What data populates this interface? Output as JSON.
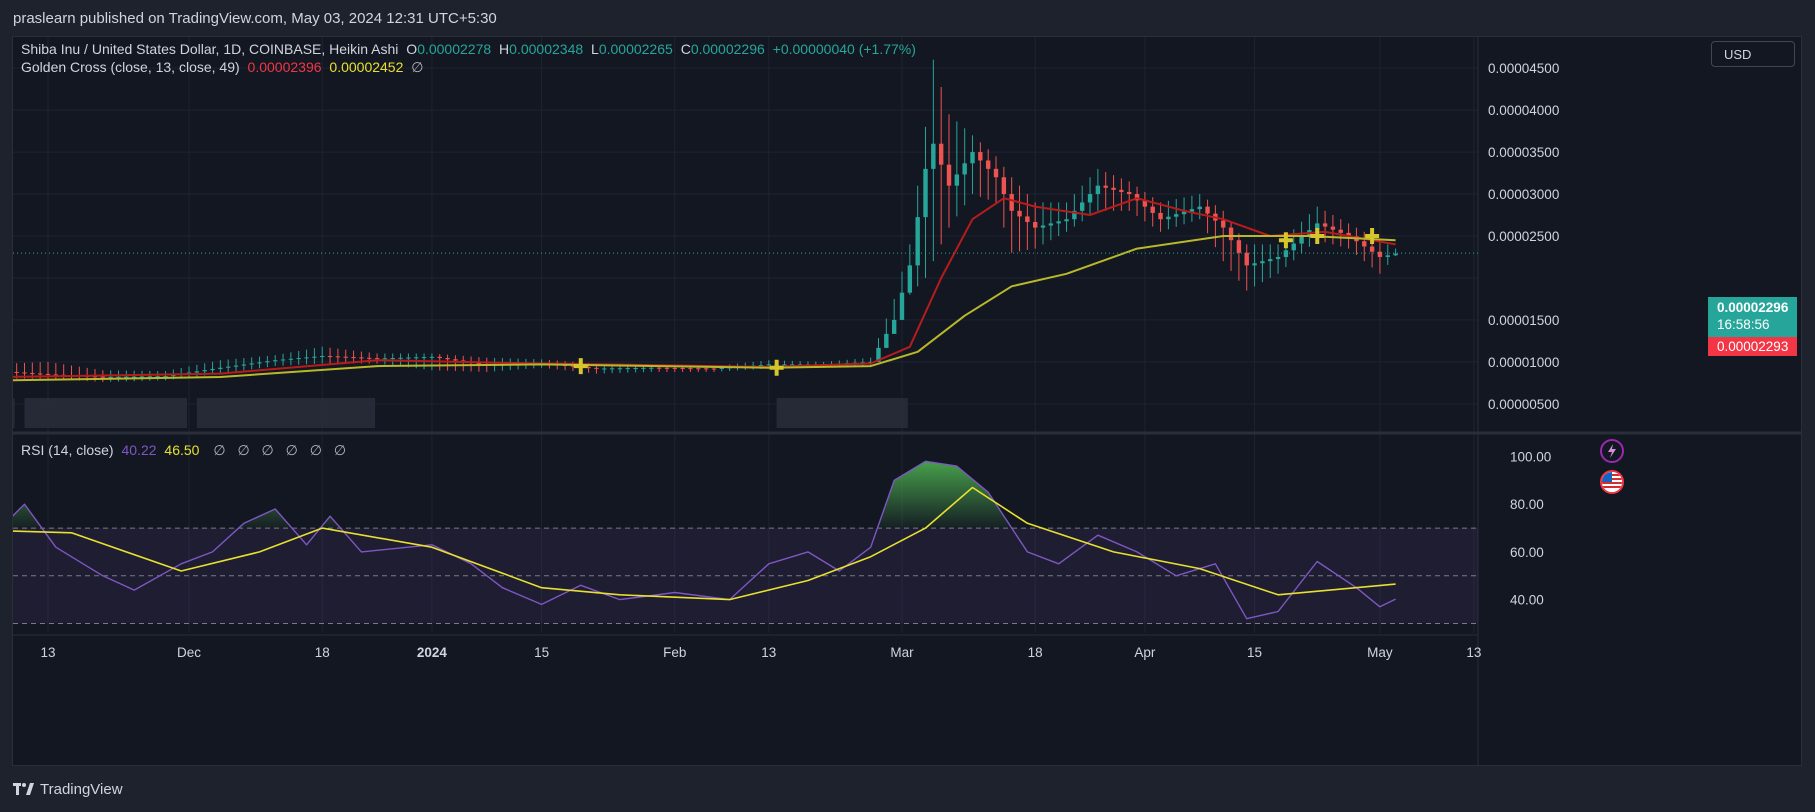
{
  "header": {
    "published": "praslearn published on TradingView.com, May 03, 2024 12:31 UTC+5:30"
  },
  "footer": {
    "brand": "TradingView"
  },
  "legend": {
    "symbol": "Shiba Inu / United States Dollar, 1D, COINBASE, Heikin Ashi",
    "o_label": "O",
    "o": "0.00002278",
    "h_label": "H",
    "h": "0.00002348",
    "l_label": "L",
    "l": "0.00002265",
    "c_label": "C",
    "c": "0.00002296",
    "change": "+0.00000040 (+1.77%)",
    "indicator": "Golden Cross (close, 13, close, 49)",
    "ma_fast": "0.00002396",
    "ma_slow": "0.00002452",
    "null_mark": "∅"
  },
  "rsi_legend": {
    "label": "RSI (14, close)",
    "rsi": "40.22",
    "ma": "46.50",
    "nulls": [
      "∅",
      "∅",
      "∅",
      "∅",
      "∅",
      "∅"
    ]
  },
  "currency_button": "USD",
  "price_tags": {
    "last": "0.00002296",
    "countdown": "16:58:56",
    "ma": "0.00002293"
  },
  "colors": {
    "up": "#26a69a",
    "down": "#ef5350",
    "ma_fast": "#b71c1c",
    "ma_slow": "#b8b82a",
    "rsi": "#7e57c2",
    "rsi_ma": "#e8e030",
    "cross": "#d4c62b",
    "tag_last": "#26a69a",
    "tag_ma": "#f23645"
  },
  "icons": [
    "lightning-icon",
    "us-flag-icon",
    "tradingview-logo-icon"
  ],
  "chart_data": [
    {
      "type": "candlestick",
      "title": "",
      "price_axis": {
        "ticks": [
          4.5e-06,
          4e-06,
          3.5e-06,
          3e-06,
          2.5e-06,
          2e-06,
          1.5e-06,
          1e-06,
          5e-07
        ],
        "tick_labels": [
          "0.00004500",
          "0.00004000",
          "0.00003500",
          "0.00003000",
          "0.00002500",
          "",
          "0.00001500",
          "0.00001000",
          "0.00000500"
        ],
        "scale_note": "price in USD",
        "ylim": [
          2e-07,
          4.8e-06
        ]
      },
      "time_axis": {
        "ticks": [
          "2023-11-13",
          "2023-12-01",
          "2023-12-18",
          "2024-01-01",
          "2024-01-15",
          "2024-02-01",
          "2024-02-13",
          "2024-03-01",
          "2024-03-18",
          "2024-04-01",
          "2024-04-15",
          "2024-05-01",
          "2024-05-13"
        ],
        "tick_labels": [
          "13",
          "Dec",
          "18",
          "2024",
          "15",
          "Feb",
          "13",
          "Mar",
          "18",
          "Apr",
          "15",
          "May",
          "13"
        ],
        "bold_labels": [
          "2024"
        ]
      },
      "keypoints": [
        {
          "date": "2023-11-08",
          "close": 8.8e-07,
          "high": 9.8e-07,
          "low": 8e-07
        },
        {
          "date": "2023-11-13",
          "close": 8.5e-07,
          "high": 1e-06,
          "low": 8e-07
        },
        {
          "date": "2023-11-20",
          "close": 8.2e-07,
          "high": 9e-07,
          "low": 7.6e-07
        },
        {
          "date": "2023-11-28",
          "close": 8.3e-07,
          "high": 8.9e-07,
          "low": 7.8e-07
        },
        {
          "date": "2023-12-05",
          "close": 9.3e-07,
          "high": 1.02e-06,
          "low": 8.6e-07
        },
        {
          "date": "2023-12-12",
          "close": 1.02e-06,
          "high": 1.08e-06,
          "low": 9.5e-07
        },
        {
          "date": "2023-12-18",
          "close": 1.07e-06,
          "high": 1.18e-06,
          "low": 9.8e-07
        },
        {
          "date": "2023-12-25",
          "close": 1.04e-06,
          "high": 1.1e-06,
          "low": 9.8e-07
        },
        {
          "date": "2024-01-01",
          "close": 1.06e-06,
          "high": 1.1e-06,
          "low": 9e-07
        },
        {
          "date": "2024-01-08",
          "close": 9.6e-07,
          "high": 1.05e-06,
          "low": 8.8e-07
        },
        {
          "date": "2024-01-15",
          "close": 9.8e-07,
          "high": 1.03e-06,
          "low": 9.3e-07
        },
        {
          "date": "2024-01-22",
          "close": 9.2e-07,
          "high": 9.8e-07,
          "low": 8.6e-07
        },
        {
          "date": "2024-01-29",
          "close": 9.3e-07,
          "high": 9.7e-07,
          "low": 8.8e-07
        },
        {
          "date": "2024-02-06",
          "close": 9.2e-07,
          "high": 9.5e-07,
          "low": 8.8e-07
        },
        {
          "date": "2024-02-13",
          "close": 9.7e-07,
          "high": 1.02e-06,
          "low": 9.2e-07
        },
        {
          "date": "2024-02-20",
          "close": 9.7e-07,
          "high": 1e-06,
          "low": 9.3e-07
        },
        {
          "date": "2024-02-26",
          "close": 1e-06,
          "high": 1.05e-06,
          "low": 9.5e-07
        },
        {
          "date": "2024-02-29",
          "close": 1.5e-06,
          "high": 1.75e-06,
          "low": 1.4e-06
        },
        {
          "date": "2024-03-02",
          "close": 2.15e-06,
          "high": 2.4e-06,
          "low": 1.8e-06
        },
        {
          "date": "2024-03-04",
          "close": 3.3e-06,
          "high": 3.8e-06,
          "low": 2e-06
        },
        {
          "date": "2024-03-05",
          "close": 3.6e-06,
          "high": 4.6e-06,
          "low": 2.2e-06
        },
        {
          "date": "2024-03-07",
          "close": 3.1e-06,
          "high": 3.95e-06,
          "low": 2.6e-06
        },
        {
          "date": "2024-03-10",
          "close": 3.5e-06,
          "high": 3.7e-06,
          "low": 3e-06
        },
        {
          "date": "2024-03-13",
          "close": 3.2e-06,
          "high": 3.45e-06,
          "low": 2.9e-06
        },
        {
          "date": "2024-03-15",
          "close": 2.8e-06,
          "high": 3.2e-06,
          "low": 2.3e-06
        },
        {
          "date": "2024-03-18",
          "close": 2.6e-06,
          "high": 2.9e-06,
          "low": 2.35e-06
        },
        {
          "date": "2024-03-22",
          "close": 2.7e-06,
          "high": 2.9e-06,
          "low": 2.55e-06
        },
        {
          "date": "2024-03-26",
          "close": 3.1e-06,
          "high": 3.3e-06,
          "low": 2.8e-06
        },
        {
          "date": "2024-03-30",
          "close": 3e-06,
          "high": 3.15e-06,
          "low": 2.8e-06
        },
        {
          "date": "2024-04-03",
          "close": 2.7e-06,
          "high": 2.9e-06,
          "low": 2.55e-06
        },
        {
          "date": "2024-04-08",
          "close": 2.85e-06,
          "high": 3e-06,
          "low": 2.7e-06
        },
        {
          "date": "2024-04-11",
          "close": 2.6e-06,
          "high": 2.8e-06,
          "low": 2.2e-06
        },
        {
          "date": "2024-04-14",
          "close": 2.15e-06,
          "high": 2.4e-06,
          "low": 1.85e-06
        },
        {
          "date": "2024-04-18",
          "close": 2.25e-06,
          "high": 2.4e-06,
          "low": 2.05e-06
        },
        {
          "date": "2024-04-23",
          "close": 2.65e-06,
          "high": 2.85e-06,
          "low": 2.45e-06
        },
        {
          "date": "2024-04-27",
          "close": 2.5e-06,
          "high": 2.65e-06,
          "low": 2.35e-06
        },
        {
          "date": "2024-05-01",
          "close": 2.25e-06,
          "high": 2.45e-06,
          "low": 2.05e-06
        },
        {
          "date": "2024-05-03",
          "close": 2.29e-06,
          "high": 2.35e-06,
          "low": 2.26e-06
        }
      ],
      "series": [
        {
          "name": "",
          "color": "#b71c1c",
          "points": [
            [
              "2023-11-08",
              8.2e-07
            ],
            [
              "2023-12-05",
              8.6e-07
            ],
            [
              "2023-12-25",
              1.02e-06
            ],
            [
              "2024-01-15",
              9.8e-07
            ],
            [
              "2024-02-13",
              9.4e-07
            ],
            [
              "2024-02-26",
              9.8e-07
            ],
            [
              "2024-03-02",
              1.18e-06
            ],
            [
              "2024-03-06",
              2e-06
            ],
            [
              "2024-03-10",
              2.7e-06
            ],
            [
              "2024-03-14",
              2.95e-06
            ],
            [
              "2024-03-18",
              2.85e-06
            ],
            [
              "2024-03-25",
              2.75e-06
            ],
            [
              "2024-03-31",
              2.95e-06
            ],
            [
              "2024-04-06",
              2.8e-06
            ],
            [
              "2024-04-11",
              2.7e-06
            ],
            [
              "2024-04-17",
              2.5e-06
            ],
            [
              "2024-04-24",
              2.55e-06
            ],
            [
              "2024-05-03",
              2.4e-06
            ]
          ]
        },
        {
          "name": "",
          "color": "#b8b82a",
          "points": [
            [
              "2023-11-08",
              7.8e-07
            ],
            [
              "2023-12-05",
              8.2e-07
            ],
            [
              "2023-12-25",
              9.5e-07
            ],
            [
              "2024-01-15",
              9.7e-07
            ],
            [
              "2024-02-13",
              9.3e-07
            ],
            [
              "2024-02-26",
              9.5e-07
            ],
            [
              "2024-03-03",
              1.12e-06
            ],
            [
              "2024-03-09",
              1.55e-06
            ],
            [
              "2024-03-15",
              1.9e-06
            ],
            [
              "2024-03-22",
              2.05e-06
            ],
            [
              "2024-03-31",
              2.35e-06
            ],
            [
              "2024-04-11",
              2.5e-06
            ],
            [
              "2024-04-22",
              2.5e-06
            ],
            [
              "2024-05-03",
              2.45e-06
            ]
          ]
        }
      ],
      "crosses": [
        {
          "date": "2024-01-20",
          "price": 9.5e-07
        },
        {
          "date": "2024-02-14",
          "price": 9.3e-07
        },
        {
          "date": "2024-04-19",
          "price": 2.45e-06
        },
        {
          "date": "2024-04-23",
          "price": 2.5e-06
        },
        {
          "date": "2024-04-30",
          "price": 2.5e-06
        }
      ],
      "shaded_ranges": [
        {
          "from": "2023-11-06",
          "to": "2023-11-09"
        },
        {
          "from": "2023-11-10",
          "to": "2023-12-01"
        },
        {
          "from": "2023-12-02",
          "to": "2023-12-25"
        },
        {
          "from": "2024-02-14",
          "to": "2024-03-02"
        }
      ],
      "last_price": 2.296e-05
    },
    {
      "type": "line",
      "title": "RSI (14, close)",
      "ylim": [
        26,
        104
      ],
      "y_ticks": [
        100,
        80,
        60,
        40
      ],
      "y_tick_labels": [
        "100.00",
        "80.00",
        "60.00",
        "40.00"
      ],
      "bands": {
        "upper": 70,
        "middle": 50,
        "lower": 30
      },
      "series": [
        {
          "name": "",
          "color": "#7e57c2",
          "points": [
            [
              "2023-11-06",
              67
            ],
            [
              "2023-11-10",
              80
            ],
            [
              "2023-11-14",
              62
            ],
            [
              "2023-11-20",
              50
            ],
            [
              "2023-11-24",
              44
            ],
            [
              "2023-11-30",
              55
            ],
            [
              "2023-12-04",
              60
            ],
            [
              "2023-12-08",
              72
            ],
            [
              "2023-12-12",
              78
            ],
            [
              "2023-12-16",
              63
            ],
            [
              "2023-12-19",
              75
            ],
            [
              "2023-12-23",
              60
            ],
            [
              "2024-01-01",
              63
            ],
            [
              "2024-01-06",
              55
            ],
            [
              "2024-01-10",
              45
            ],
            [
              "2024-01-15",
              38
            ],
            [
              "2024-01-20",
              46
            ],
            [
              "2024-01-25",
              40
            ],
            [
              "2024-02-01",
              43
            ],
            [
              "2024-02-08",
              40
            ],
            [
              "2024-02-13",
              55
            ],
            [
              "2024-02-18",
              60
            ],
            [
              "2024-02-22",
              52
            ],
            [
              "2024-02-26",
              62
            ],
            [
              "2024-02-29",
              90
            ],
            [
              "2024-03-04",
              98
            ],
            [
              "2024-03-08",
              96
            ],
            [
              "2024-03-12",
              85
            ],
            [
              "2024-03-17",
              60
            ],
            [
              "2024-03-21",
              55
            ],
            [
              "2024-03-26",
              67
            ],
            [
              "2024-03-31",
              60
            ],
            [
              "2024-04-05",
              50
            ],
            [
              "2024-04-10",
              55
            ],
            [
              "2024-04-14",
              32
            ],
            [
              "2024-04-18",
              35
            ],
            [
              "2024-04-23",
              56
            ],
            [
              "2024-04-28",
              45
            ],
            [
              "2024-05-01",
              37
            ],
            [
              "2024-05-03",
              40.22
            ]
          ]
        },
        {
          "name": "",
          "color": "#e8e030",
          "points": [
            [
              "2023-11-06",
              69
            ],
            [
              "2023-11-16",
              68
            ],
            [
              "2023-11-30",
              52
            ],
            [
              "2023-12-10",
              60
            ],
            [
              "2023-12-18",
              70
            ],
            [
              "2024-01-01",
              62
            ],
            [
              "2024-01-15",
              45
            ],
            [
              "2024-01-25",
              42
            ],
            [
              "2024-02-08",
              40
            ],
            [
              "2024-02-18",
              48
            ],
            [
              "2024-02-26",
              58
            ],
            [
              "2024-03-04",
              70
            ],
            [
              "2024-03-10",
              87
            ],
            [
              "2024-03-17",
              72
            ],
            [
              "2024-03-28",
              60
            ],
            [
              "2024-04-08",
              53
            ],
            [
              "2024-04-18",
              42
            ],
            [
              "2024-05-03",
              46.5
            ]
          ]
        }
      ]
    }
  ]
}
